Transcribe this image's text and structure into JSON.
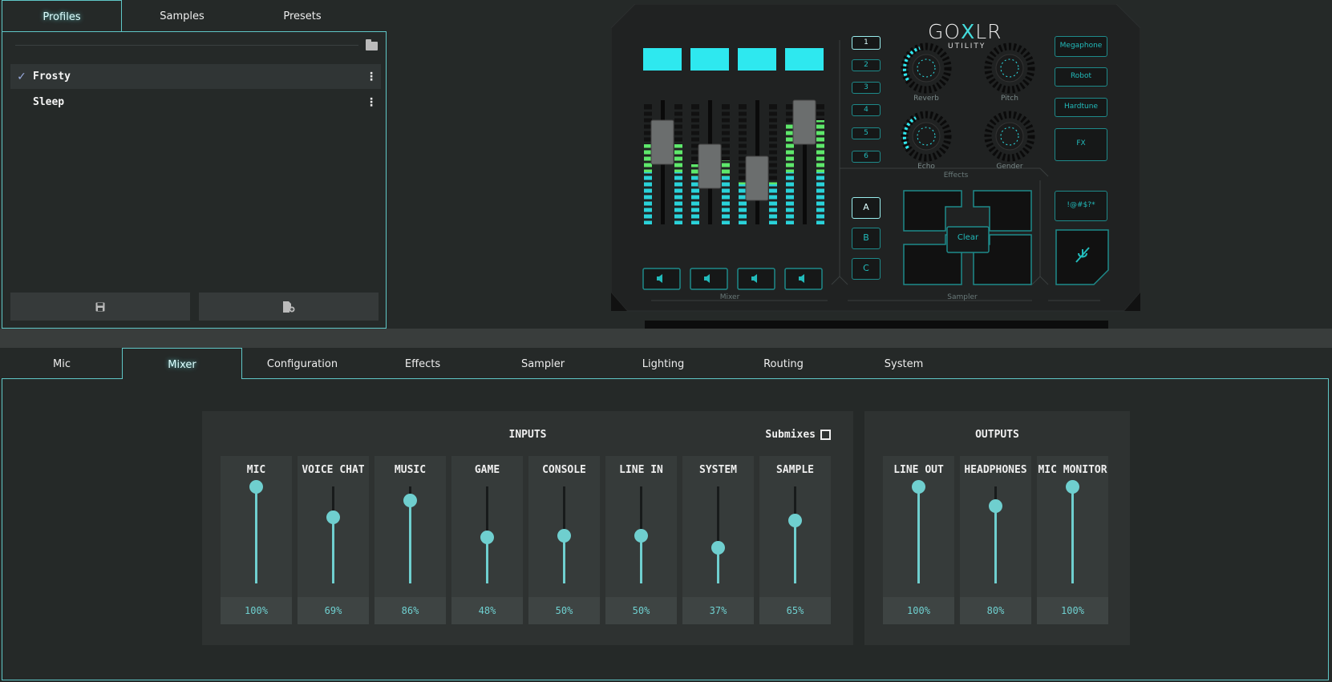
{
  "profiles_tabs": [
    {
      "label": "Profiles",
      "active": true
    },
    {
      "label": "Samples",
      "active": false
    },
    {
      "label": "Presets",
      "active": false
    }
  ],
  "profiles": [
    {
      "name": "Frosty",
      "selected": true
    },
    {
      "name": "Sleep",
      "selected": false
    }
  ],
  "device": {
    "brand": "GOXLR",
    "brand_sub": "UTILITY",
    "presets": [
      "1",
      "2",
      "3",
      "4",
      "5",
      "6"
    ],
    "effect_buttons": [
      "Megaphone",
      "Robot",
      "Hardtune",
      "FX"
    ],
    "knobs": [
      "Reverb",
      "Pitch",
      "Echo",
      "Gender"
    ],
    "effects_label": "Effects",
    "banks": [
      "A",
      "B",
      "C"
    ],
    "clear_label": "Clear",
    "bleep_label": "!@#$?*",
    "mixer_label": "Mixer",
    "sampler_label": "Sampler",
    "accent_color": "#2ad4d4"
  },
  "main_tabs": [
    {
      "label": "Mic",
      "active": false
    },
    {
      "label": "Mixer",
      "active": true
    },
    {
      "label": "Configuration",
      "active": false
    },
    {
      "label": "Effects",
      "active": false
    },
    {
      "label": "Sampler",
      "active": false
    },
    {
      "label": "Lighting",
      "active": false
    },
    {
      "label": "Routing",
      "active": false
    },
    {
      "label": "System",
      "active": false
    }
  ],
  "inputs": {
    "title": "INPUTS",
    "submixes_label": "Submixes",
    "submixes_checked": false,
    "channels": [
      {
        "name": "MIC",
        "value": 100,
        "label": "100%"
      },
      {
        "name": "VOICE CHAT",
        "value": 69,
        "label": "69%"
      },
      {
        "name": "MUSIC",
        "value": 86,
        "label": "86%"
      },
      {
        "name": "GAME",
        "value": 48,
        "label": "48%"
      },
      {
        "name": "CONSOLE",
        "value": 50,
        "label": "50%"
      },
      {
        "name": "LINE IN",
        "value": 50,
        "label": "50%"
      },
      {
        "name": "SYSTEM",
        "value": 37,
        "label": "37%"
      },
      {
        "name": "SAMPLE",
        "value": 65,
        "label": "65%"
      }
    ]
  },
  "outputs": {
    "title": "OUTPUTS",
    "channels": [
      {
        "name": "LINE OUT",
        "value": 100,
        "label": "100%"
      },
      {
        "name": "HEADPHONES",
        "value": 80,
        "label": "80%"
      },
      {
        "name": "MIC MONITOR",
        "value": 100,
        "label": "100%"
      }
    ]
  }
}
